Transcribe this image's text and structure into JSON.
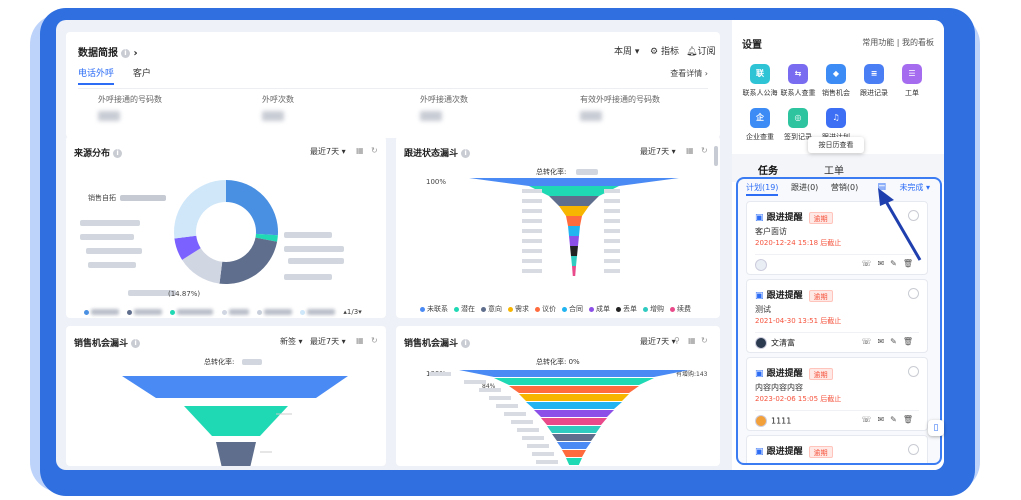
{
  "overview": {
    "title": "数据简报",
    "period": "本周",
    "metric_btn": "指标",
    "subscribe_btn": "订阅",
    "tabs": [
      "电话外呼",
      "客户"
    ],
    "view_detail": "查看详情",
    "stats": [
      "外呼接通的号码数",
      "外呼次数",
      "外呼接通次数",
      "有效外呼接通的号码数"
    ]
  },
  "source_card": {
    "title": "来源分布",
    "range": "最近7天",
    "label_left": "销售自拓",
    "label_bottom": "(14.87%)",
    "pager": "1/3",
    "colors": [
      "#4a90e2",
      "#1fd8b4",
      "#5f6e8c",
      "#d0d6e2",
      "#7b61ff",
      "#cfe7f9"
    ]
  },
  "follow_card": {
    "title": "跟进状态漏斗",
    "range": "最近7天",
    "total_rate": "总转化率:",
    "percent": "100%",
    "legend": [
      "未联系",
      "潜在",
      "意向",
      "需求",
      "议价",
      "合同",
      "成单",
      "丢单",
      "增购",
      "续费"
    ],
    "legend_colors": [
      "#4a8af4",
      "#1fd8b4",
      "#5f6e8c",
      "#f7b500",
      "#ff6b3d",
      "#21b4f0",
      "#8c4fe8",
      "#222222",
      "#2fcbc0",
      "#e84a8a"
    ]
  },
  "opp_card": {
    "title": "销售机会漏斗",
    "filter": "新签",
    "range": "最近7天",
    "total_rate": "总转化率:"
  },
  "opp_follow_card": {
    "title": "销售机会漏斗",
    "range": "最近7天",
    "total_rate": "总转化率: 0%",
    "percent": "100%",
    "right_label": "有增购:143",
    "left_label": "84%"
  },
  "settings": {
    "title": "设置",
    "links": "常用功能 | 我的看板",
    "tools": [
      {
        "label": "联系人公海",
        "icon": "联",
        "color": "#2ec4d6"
      },
      {
        "label": "联系人查重",
        "icon": "⇆",
        "color": "#7a6cf0"
      },
      {
        "label": "销售机会",
        "icon": "◆",
        "color": "#3d8bf5"
      },
      {
        "label": "跟进记录",
        "icon": "≡",
        "color": "#4a7ef5"
      },
      {
        "label": "工单",
        "icon": "☰",
        "color": "#a56cf0"
      },
      {
        "label": "企业查重",
        "icon": "企",
        "color": "#3d8bf5"
      },
      {
        "label": "签到记录",
        "icon": "◎",
        "color": "#2ec4a0"
      },
      {
        "label": "跟进计划",
        "icon": "♫",
        "color": "#3d6ff5"
      }
    ]
  },
  "tasks": {
    "tabs": [
      "任务",
      "工单"
    ],
    "tooltip": "按日历查看",
    "subtabs": [
      "计划(19)",
      "跟进(0)",
      "营销(0)"
    ],
    "filter": "未完成",
    "cards": [
      {
        "title": "跟进提醒",
        "badge": "逾期",
        "name": "客户面访",
        "due": "2020-12-24 15:18 后截止",
        "owner": ""
      },
      {
        "title": "跟进提醒",
        "badge": "逾期",
        "name": "测试",
        "due": "2021-04-30 13:51 后截止",
        "owner": "文清富"
      },
      {
        "title": "跟进提醒",
        "badge": "逾期",
        "name": "内容内容内容",
        "due": "2023-02-06 15:05 后截止",
        "owner": "1111"
      },
      {
        "title": "跟进提醒",
        "badge": "逾期",
        "name": "",
        "due": "",
        "owner": ""
      }
    ]
  }
}
